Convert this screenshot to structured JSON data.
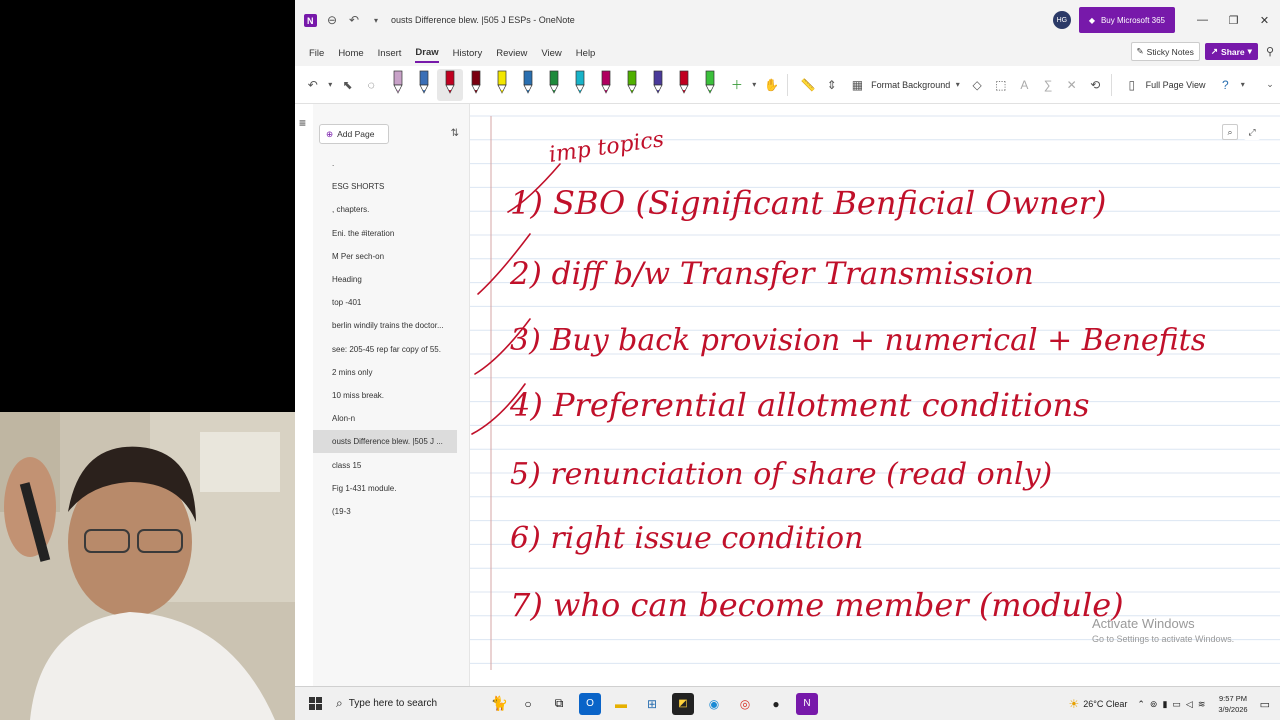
{
  "window": {
    "title": "ousts Difference blew. |505 J ESPs  -  OneNote",
    "user_initials": "HG",
    "buy_button": "Buy Microsoft 365",
    "controls": {
      "minimize": "—",
      "restore": "❐",
      "close": "✕"
    }
  },
  "menu": {
    "items": [
      "File",
      "Home",
      "Insert",
      "Draw",
      "History",
      "Review",
      "View",
      "Help"
    ],
    "active": "Draw",
    "sticky_notes": "Sticky Notes",
    "share": "Share"
  },
  "ribbon": {
    "format_background": "Format Background",
    "full_page_view": "Full Page View",
    "pen_colors": [
      "#c8a2c8",
      "#3b6fb6",
      "#c00020",
      "#7a0010",
      "#f2e600",
      "#2a6fb0",
      "#1f8a3c",
      "#18b3c8",
      "#b00060",
      "#50b000",
      "#4a3a9a",
      "#c00020",
      "#3cc03c"
    ],
    "accent": "#7719aa"
  },
  "pages": {
    "add_page": "Add Page",
    "items": [
      ".",
      "ESG SHORTS",
      ", chapters.",
      "Eni. the #iteration",
      "M Per sech-on",
      "Heading",
      "top -401",
      "berlin windily trains the doctor...",
      "see: 205-45 rep far copy of 55.",
      "2 mins only",
      "10 miss break.",
      "Alon-n",
      "ousts Difference blew. |505 J ...",
      "class 15",
      "Fig 1-431 module.",
      "(19-3"
    ],
    "selected_index": 12
  },
  "notes": {
    "ink_color": "#c0102a",
    "heading": "imp topics",
    "lines": [
      "1) SBO (Significant Benficial Owner)",
      "2) diff b/w Transfer Transmission",
      "3) Buy back provision + numerical + Benefits",
      "4) Preferential allotment conditions",
      "5) renunciation of share (read only)",
      "6) right issue condition",
      "7) who can become member (module)"
    ]
  },
  "watermark": {
    "line1": "Activate Windows",
    "line2": "Go to Settings to activate Windows."
  },
  "taskbar": {
    "search_placeholder": "Type here to search",
    "weather": "26°C  Clear",
    "time": "9:57 PM",
    "date": "3/9/2026"
  }
}
